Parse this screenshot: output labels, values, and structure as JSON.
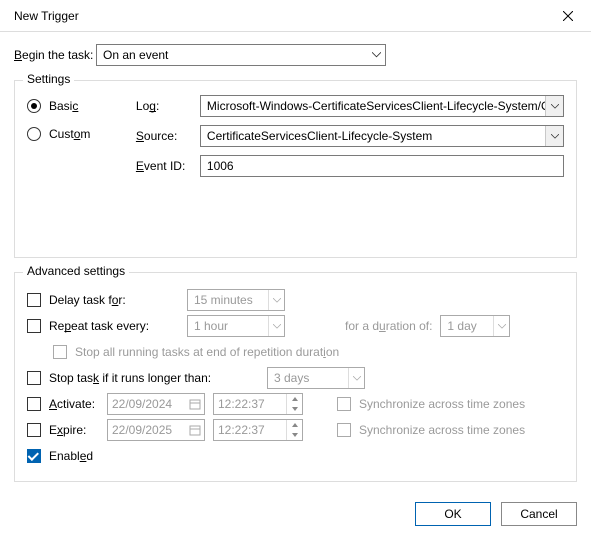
{
  "window": {
    "title": "New Trigger"
  },
  "begin": {
    "label": "Begin the task:",
    "value": "On an event"
  },
  "settings": {
    "legend": "Settings",
    "radio_basic": "Basic",
    "radio_custom": "Custom",
    "log_label": "Log:",
    "log_value": "Microsoft-Windows-CertificateServicesClient-Lifecycle-System/Op",
    "source_label": "Source:",
    "source_value": "CertificateServicesClient-Lifecycle-System",
    "eventid_label": "Event ID:",
    "eventid_value": "1006"
  },
  "advanced": {
    "legend": "Advanced settings",
    "delay_label": "Delay task for:",
    "delay_value": "15 minutes",
    "repeat_label": "Repeat task every:",
    "repeat_value": "1 hour",
    "duration_label": "for a duration of:",
    "duration_value": "1 day",
    "stop_all_label": "Stop all running tasks at end of repetition duration",
    "stop_if_longer_label": "Stop task if it runs longer than:",
    "stop_if_longer_value": "3 days",
    "activate_label": "Activate:",
    "activate_date": "22/09/2024",
    "activate_time": "12:22:37",
    "expire_label": "Expire:",
    "expire_date": "22/09/2025",
    "expire_time": "12:22:37",
    "sync_label": "Synchronize across time zones",
    "enabled_label": "Enabled"
  },
  "footer": {
    "ok": "OK",
    "cancel": "Cancel"
  }
}
